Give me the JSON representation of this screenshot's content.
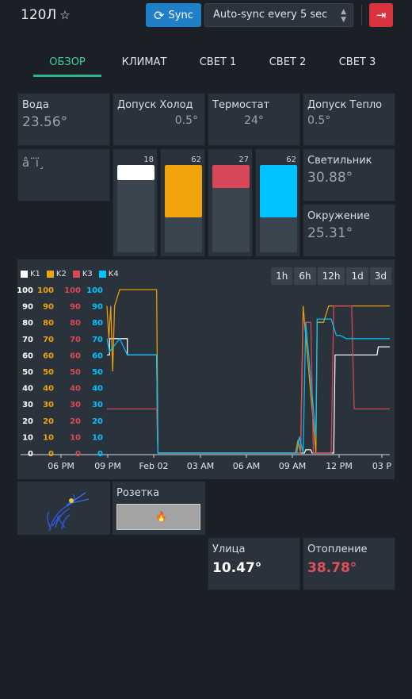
{
  "header": {
    "title": "120Л",
    "star_icon": "☆",
    "sync_label": "Sync",
    "autosync": "Auto-sync every 5 sec"
  },
  "tabs": [
    {
      "label": "ОБЗОР",
      "active": true
    },
    {
      "label": "КЛИМАТ",
      "active": false
    },
    {
      "label": "СВЕТ 1",
      "active": false
    },
    {
      "label": "СВЕТ 2",
      "active": false
    },
    {
      "label": "СВЕТ 3",
      "active": false
    }
  ],
  "cards": {
    "water": {
      "label": "Вода",
      "value": "23.56°"
    },
    "tol_cold": {
      "label": "Допуск Холод",
      "value": "0.5°"
    },
    "thermostat": {
      "label": "Термостат",
      "value": "24°"
    },
    "tol_warm": {
      "label": "Допуск Тепло",
      "value": "0.5°"
    },
    "garbled": {
      "label": "â¨ï¸"
    },
    "lamp": {
      "label": "Светильник",
      "value": "30.88°"
    },
    "ambient": {
      "label": "Окружение",
      "value": "25.31°"
    },
    "socket": {
      "label": "Розетка"
    },
    "street": {
      "label": "Улица",
      "value": "10.47°"
    },
    "heating": {
      "label": "Отопление",
      "value": "38.78°"
    }
  },
  "channels": [
    {
      "name": "K1",
      "value": 18,
      "color": "#ffffff"
    },
    {
      "name": "K2",
      "value": 62,
      "color": "#f0a30a"
    },
    {
      "name": "K3",
      "value": 27,
      "color": "#d9485a"
    },
    {
      "name": "K4",
      "value": 62,
      "color": "#00c3ff"
    }
  ],
  "ranges": [
    "1h",
    "6h",
    "12h",
    "1d",
    "3d"
  ],
  "colors": {
    "heating_value": "#e0505e",
    "accent": "#2ab886"
  },
  "chart_data": {
    "type": "line",
    "x_ticks": [
      "06 PM",
      "09 PM",
      "Feb 02",
      "03 AM",
      "06 AM",
      "09 AM",
      "12 PM",
      "03 P"
    ],
    "y_ticks": [
      0,
      10,
      20,
      30,
      40,
      50,
      60,
      70,
      80,
      90,
      100
    ],
    "ylim": [
      0,
      100
    ],
    "series": [
      {
        "name": "K1",
        "color": "#ffffff",
        "x": [
          0,
          0.2,
          0.2,
          1.6,
          1.6,
          3.9,
          4.0,
          4.2,
          15.5,
          15.6,
          16.0,
          16.1,
          17.8,
          17.9,
          19.3,
          19.4,
          21.2,
          21.3,
          22.2
        ],
        "y": [
          60,
          60,
          70,
          70,
          60,
          60,
          0,
          0,
          0,
          2,
          2,
          0,
          0,
          60,
          60,
          60,
          60,
          65,
          65
        ]
      },
      {
        "name": "K2",
        "color": "#f0a30a",
        "x": [
          0,
          0.15,
          0.3,
          0.45,
          0.6,
          1.0,
          1.5,
          3.9,
          4.0,
          4.2,
          14.8,
          15.0,
          15.2,
          15.4,
          16.4,
          16.5,
          17.0,
          17.4,
          18.0,
          18.2,
          19.1,
          22.2
        ],
        "y": [
          90,
          70,
          90,
          50,
          90,
          100,
          100,
          100,
          0,
          0,
          0,
          8,
          0,
          90,
          0,
          80,
          80,
          90,
          90,
          90,
          90,
          90
        ]
      },
      {
        "name": "K3",
        "color": "#d9485a",
        "x": [
          0,
          0.5,
          1.0,
          1.5,
          3.9,
          4.0,
          4.2,
          15.2,
          15.4,
          16.0,
          16.2,
          17.6,
          17.8,
          19.2,
          19.4,
          22.2
        ],
        "y": [
          27,
          27,
          27,
          27,
          27,
          0,
          0,
          0,
          80,
          80,
          0,
          0,
          90,
          90,
          27,
          27
        ]
      },
      {
        "name": "K4",
        "color": "#00c3ff",
        "x": [
          0,
          0.2,
          1.0,
          1.6,
          2.0,
          3.9,
          4.0,
          4.2,
          14.9,
          15.1,
          15.4,
          15.6,
          16.4,
          16.5,
          17.4,
          17.6,
          18.0,
          18.3,
          18.8,
          19.1,
          20.0,
          21.5,
          22.2
        ],
        "y": [
          70,
          62,
          70,
          60,
          60,
          60,
          0,
          0,
          0,
          10,
          0,
          80,
          10,
          82,
          82,
          82,
          72,
          72,
          70,
          70,
          70,
          70,
          70
        ]
      }
    ]
  }
}
